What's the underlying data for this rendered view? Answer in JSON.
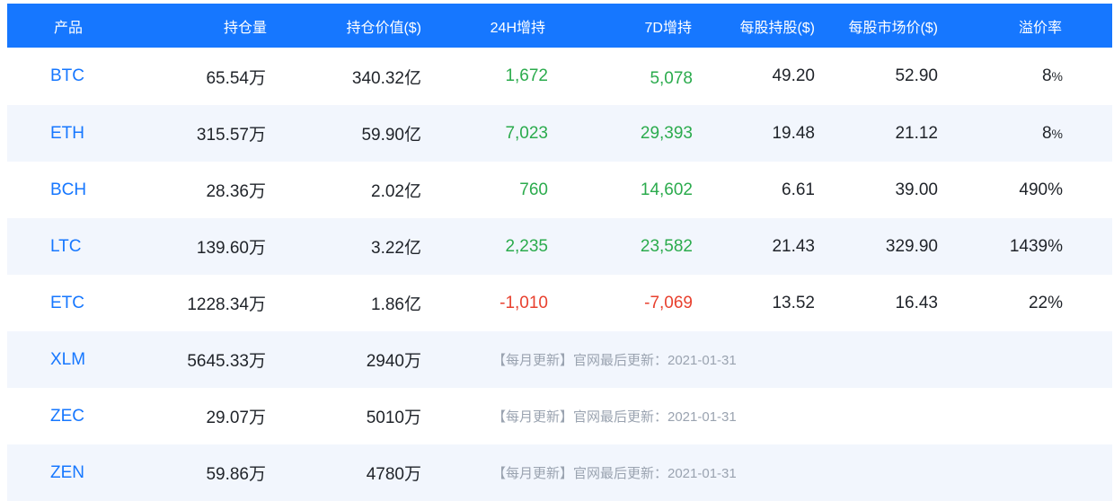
{
  "colors": {
    "header_bg": "#1677ff",
    "header_text": "#ffffff",
    "product_text": "#1677ff",
    "positive": "#2bab4d",
    "negative": "#e8412f",
    "note_text": "#9aa3b0",
    "row_shade": "#f2f6fd"
  },
  "table": {
    "columns": [
      "产品",
      "持仓量",
      "持仓价值($)",
      "24H增持",
      "7D增持",
      "每股持股($)",
      "每股市场价($)",
      "溢价率"
    ],
    "rows": [
      {
        "product": "BTC",
        "holdings": "65.54万",
        "value": "340.32亿",
        "change_24h": "1,672",
        "change_7d": "5,078",
        "per_share": "49.20",
        "market_price": "52.90",
        "premium": "8",
        "premium_unit": "%"
      },
      {
        "product": "ETH",
        "holdings": "315.57万",
        "value": "59.90亿",
        "change_24h": "7,023",
        "change_7d": "29,393",
        "per_share": "19.48",
        "market_price": "21.12",
        "premium": "8",
        "premium_unit": "%"
      },
      {
        "product": "BCH",
        "holdings": "28.36万",
        "value": "2.02亿",
        "change_24h": "760",
        "change_7d": "14,602",
        "per_share": "6.61",
        "market_price": "39.00",
        "premium": "490%",
        "premium_unit": ""
      },
      {
        "product": "LTC",
        "holdings": "139.60万",
        "value": "3.22亿",
        "change_24h": "2,235",
        "change_7d": "23,582",
        "per_share": "21.43",
        "market_price": "329.90",
        "premium": "1439%",
        "premium_unit": ""
      },
      {
        "product": "ETC",
        "holdings": "1228.34万",
        "value": "1.86亿",
        "change_24h": "-1,010",
        "change_7d": "-7,069",
        "per_share": "13.52",
        "market_price": "16.43",
        "premium": "22%",
        "premium_unit": ""
      },
      {
        "product": "XLM",
        "holdings": "5645.33万",
        "value": "2940万",
        "note": "【每月更新】官网最后更新：2021-01-31"
      },
      {
        "product": "ZEC",
        "holdings": "29.07万",
        "value": "5010万",
        "note": "【每月更新】官网最后更新：2021-01-31"
      },
      {
        "product": "ZEN",
        "holdings": "59.86万",
        "value": "4780万",
        "note": "【每月更新】官网最后更新：2021-01-31"
      }
    ]
  }
}
